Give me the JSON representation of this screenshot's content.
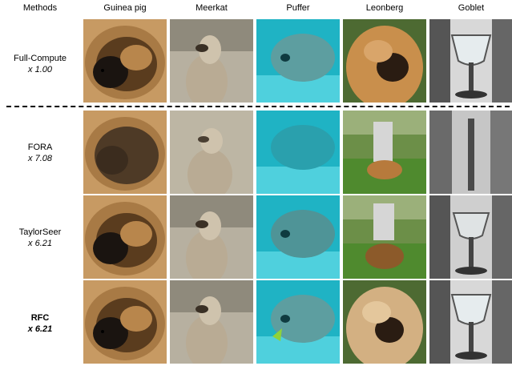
{
  "columns": [
    {
      "label": "Methods"
    },
    {
      "label": "Guinea pig"
    },
    {
      "label": "Meerkat"
    },
    {
      "label": "Puffer"
    },
    {
      "label": "Leonberg"
    },
    {
      "label": "Goblet"
    }
  ],
  "rows": [
    {
      "method": "Full-Compute",
      "speedup": "x 1.00",
      "bold": false
    },
    {
      "method": "FORA",
      "speedup": "x 7.08",
      "bold": false
    },
    {
      "method": "TaylorSeer",
      "speedup": "x 6.21",
      "bold": false
    },
    {
      "method": "RFC",
      "speedup": "x 6.21",
      "bold": true
    }
  ]
}
